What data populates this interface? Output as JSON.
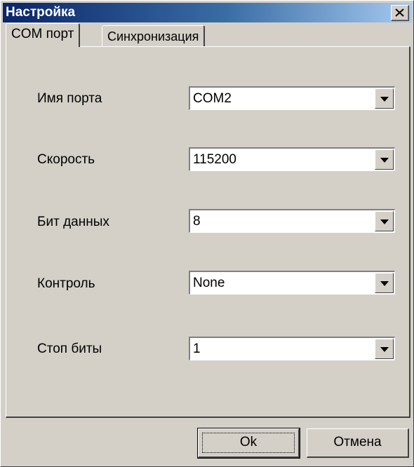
{
  "window": {
    "title": "Настройка"
  },
  "tabs": [
    {
      "label": "COM порт",
      "active": true
    },
    {
      "label": "Синхронизация",
      "active": false
    }
  ],
  "fields": [
    {
      "label": "Имя порта",
      "value": "COM2"
    },
    {
      "label": "Скорость",
      "value": "115200"
    },
    {
      "label": "Бит данных",
      "value": "8"
    },
    {
      "label": "Контроль",
      "value": "None"
    },
    {
      "label": "Стоп биты",
      "value": "1"
    }
  ],
  "buttons": {
    "ok": "Ok",
    "cancel": "Отмена"
  },
  "icons": {
    "close": "close-icon",
    "dropdown": "chevron-down-icon"
  }
}
